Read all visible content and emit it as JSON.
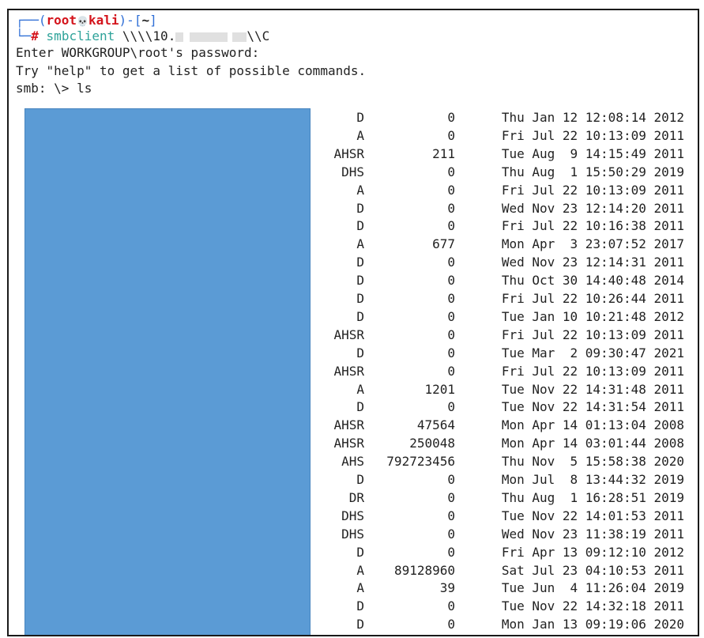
{
  "prompt": {
    "corner_top": "┌──(",
    "user": "root",
    "skull": "💀",
    "host": "kali",
    "mid": ")-[",
    "dir": "~",
    "end": "]",
    "corner_bottom": "└─",
    "hash": "#"
  },
  "command": {
    "name": "smbclient",
    "arg_prefix": "\\\\\\\\10.",
    "arg_suffix": "\\\\C"
  },
  "output": {
    "password_prompt": "Enter WORKGROUP\\root's password:",
    "help_hint": "Try \"help\" to get a list of possible commands.",
    "smb_prompt": "smb: \\> ",
    "smb_command": "ls"
  },
  "colors": {
    "redaction_box": "#5b9bd5",
    "prompt_red": "#d4141c",
    "prompt_blue": "#2f6fd6",
    "command_teal": "#2fa39a"
  },
  "listing": [
    {
      "attr": "D",
      "size": "0",
      "date": "Thu Jan 12 12:08:14 2012"
    },
    {
      "attr": "A",
      "size": "0",
      "date": "Fri Jul 22 10:13:09 2011"
    },
    {
      "attr": "AHSR",
      "size": "211",
      "date": "Tue Aug  9 14:15:49 2011"
    },
    {
      "attr": "DHS",
      "size": "0",
      "date": "Thu Aug  1 15:50:29 2019"
    },
    {
      "attr": "A",
      "size": "0",
      "date": "Fri Jul 22 10:13:09 2011"
    },
    {
      "attr": "D",
      "size": "0",
      "date": "Wed Nov 23 12:14:20 2011"
    },
    {
      "attr": "D",
      "size": "0",
      "date": "Fri Jul 22 10:16:38 2011"
    },
    {
      "attr": "A",
      "size": "677",
      "date": "Mon Apr  3 23:07:52 2017"
    },
    {
      "attr": "D",
      "size": "0",
      "date": "Wed Nov 23 12:14:31 2011"
    },
    {
      "attr": "D",
      "size": "0",
      "date": "Thu Oct 30 14:40:48 2014"
    },
    {
      "attr": "D",
      "size": "0",
      "date": "Fri Jul 22 10:26:44 2011"
    },
    {
      "attr": "D",
      "size": "0",
      "date": "Tue Jan 10 10:21:48 2012"
    },
    {
      "attr": "AHSR",
      "size": "0",
      "date": "Fri Jul 22 10:13:09 2011"
    },
    {
      "attr": "D",
      "size": "0",
      "date": "Tue Mar  2 09:30:47 2021"
    },
    {
      "attr": "AHSR",
      "size": "0",
      "date": "Fri Jul 22 10:13:09 2011"
    },
    {
      "attr": "A",
      "size": "1201",
      "date": "Tue Nov 22 14:31:48 2011"
    },
    {
      "attr": "D",
      "size": "0",
      "date": "Tue Nov 22 14:31:54 2011"
    },
    {
      "attr": "AHSR",
      "size": "47564",
      "date": "Mon Apr 14 01:13:04 2008"
    },
    {
      "attr": "AHSR",
      "size": "250048",
      "date": "Mon Apr 14 03:01:44 2008"
    },
    {
      "attr": "AHS",
      "size": "792723456",
      "date": "Thu Nov  5 15:58:38 2020"
    },
    {
      "attr": "D",
      "size": "0",
      "date": "Mon Jul  8 13:44:32 2019"
    },
    {
      "attr": "DR",
      "size": "0",
      "date": "Thu Aug  1 16:28:51 2019"
    },
    {
      "attr": "DHS",
      "size": "0",
      "date": "Tue Nov 22 14:01:53 2011"
    },
    {
      "attr": "DHS",
      "size": "0",
      "date": "Wed Nov 23 11:38:19 2011"
    },
    {
      "attr": "D",
      "size": "0",
      "date": "Fri Apr 13 09:12:10 2012"
    },
    {
      "attr": "A",
      "size": "89128960",
      "date": "Sat Jul 23 04:10:53 2011"
    },
    {
      "attr": "A",
      "size": "39",
      "date": "Tue Jun  4 11:26:04 2019"
    },
    {
      "attr": "D",
      "size": "0",
      "date": "Tue Nov 22 14:32:18 2011"
    },
    {
      "attr": "D",
      "size": "0",
      "date": "Mon Jan 13 09:19:06 2020"
    }
  ]
}
